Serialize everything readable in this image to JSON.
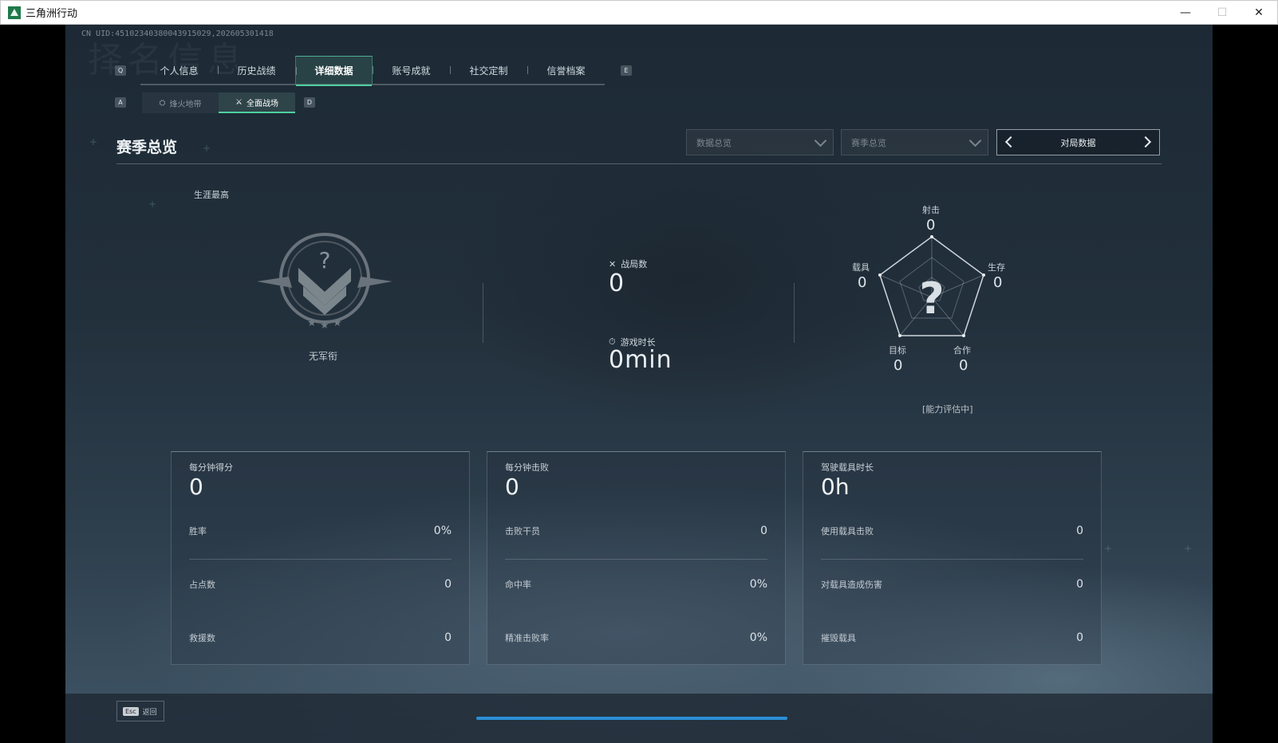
{
  "window": {
    "title": "三角洲行动",
    "controls": {
      "minimize": "—",
      "maximize": "☐",
      "close": "✕"
    }
  },
  "uid_line": "CN UID:45102340380043915029,202605301418",
  "background_watermark": "择名信息",
  "main_tabs": {
    "left_key": "Q",
    "right_key": "E",
    "items": [
      {
        "label": "个人信息",
        "active": false
      },
      {
        "label": "历史战绩",
        "active": false
      },
      {
        "label": "详细数据",
        "active": true
      },
      {
        "label": "账号成就",
        "active": false
      },
      {
        "label": "社交定制",
        "active": false
      },
      {
        "label": "信誉档案",
        "active": false
      }
    ]
  },
  "sub_tabs": {
    "left_key": "A",
    "right_key": "D",
    "items": [
      {
        "label": "烽火地带",
        "icon": "beacon-icon",
        "active": false
      },
      {
        "label": "全面战场",
        "icon": "battlefield-icon",
        "active": true
      }
    ]
  },
  "section": {
    "title": "赛季总览",
    "dropdown1_placeholder": "数据总览",
    "dropdown2_placeholder": "赛季总览",
    "pager_label": "对局数据"
  },
  "rank": {
    "career_label": "生涯最高",
    "rank_name": "无军衔",
    "badge_mark": "?"
  },
  "center_stats": {
    "matches_label": "战局数",
    "matches_value": "0",
    "playtime_label": "游戏时长",
    "playtime_value": "0min"
  },
  "radar": {
    "center_mark": "?",
    "axes": [
      {
        "label": "射击",
        "value": "0"
      },
      {
        "label": "生存",
        "value": "0"
      },
      {
        "label": "合作",
        "value": "0"
      },
      {
        "label": "目标",
        "value": "0"
      },
      {
        "label": "载具",
        "value": "0"
      }
    ],
    "note": "[能力评估中]"
  },
  "cards": [
    {
      "title": "每分钟得分",
      "big_value": "0",
      "rows": [
        {
          "label": "胜率",
          "value": "0%"
        },
        {
          "label": "占点数",
          "value": "0"
        },
        {
          "label": "救援数",
          "value": "0"
        }
      ]
    },
    {
      "title": "每分钟击败",
      "big_value": "0",
      "rows": [
        {
          "label": "击败干员",
          "value": "0"
        },
        {
          "label": "命中率",
          "value": "0%"
        },
        {
          "label": "精准击败率",
          "value": "0%"
        }
      ]
    },
    {
      "title": "驾驶载具时长",
      "big_value": "0h",
      "rows": [
        {
          "label": "使用载具击败",
          "value": "0"
        },
        {
          "label": "对载具造成伤害",
          "value": "0"
        },
        {
          "label": "摧毁载具",
          "value": "0"
        }
      ]
    }
  ],
  "footer": {
    "esc_key": "Esc",
    "back_label": "返回"
  },
  "colors": {
    "accent": "#4fd0a0",
    "progress": "#2a8fd6",
    "background": "#22303c"
  }
}
